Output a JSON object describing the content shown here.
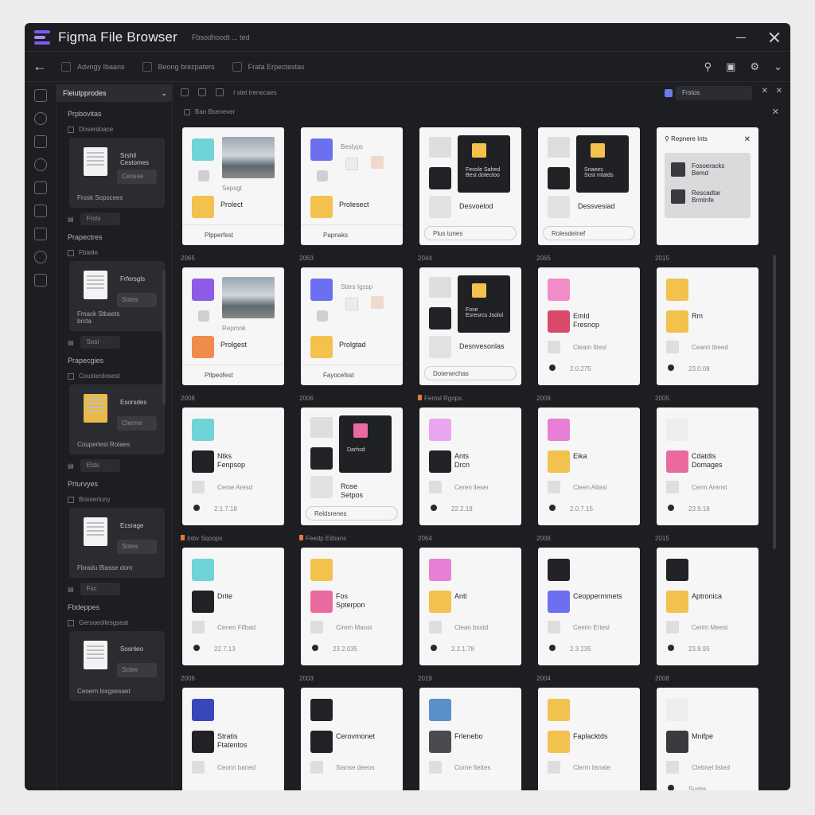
{
  "app": {
    "title": "Figma File Browser",
    "subtitle": "Fbsodhoodt ... ted"
  },
  "toolbar": {
    "crumbs": [
      "Advngy Ibaans",
      "Beong brezpaters",
      "Frata Erpectestas"
    ]
  },
  "panel": {
    "header": "Fleiutpprodes",
    "groups": [
      {
        "title": "Prpbovitas",
        "sub": "Doserdoace",
        "card_label": "Srshil\nCestomes",
        "card_pill": "Ceosse",
        "card_foot": "Frosk Sopscees",
        "btn": "Frsts",
        "doc": "doc"
      },
      {
        "title": "Prapectres",
        "sub": "Fbtelle",
        "card_label": "Frfersgls",
        "card_pill": "Sotes",
        "card_foot": "Fmack Stbaets\nbrcta",
        "btn": "Sosi",
        "doc": "doc"
      },
      {
        "title": "Prapecgies",
        "sub": "Cousterdosest",
        "card_label": "Esorsdes",
        "card_pill": "Clerme",
        "card_foot": "Couperlest Rotaes",
        "btn": "Etds",
        "doc": "folder"
      },
      {
        "title": "Prturvyes",
        "sub": "Bosseriuny",
        "card_label": "Ecsrage",
        "card_pill": "Sotes",
        "card_foot": "Fbradu Blasse dom",
        "btn": "Fsc",
        "doc": "doc"
      },
      {
        "title": "Fbdeppes",
        "sub": "Gersoeollesgseat",
        "card_label": "Sosnleo",
        "card_pill": "Sclee",
        "card_foot": "Ceoern losgsesaet",
        "btn": "",
        "doc": "doc"
      }
    ]
  },
  "main": {
    "head_label": "I stet trenecaes",
    "search": "Frstos",
    "section": "Ban Bsenever"
  },
  "cards": [
    {
      "row": "",
      "name": "Prolect",
      "meta": "Sepsgt",
      "foot": "Plpperfest",
      "icon": "#6fd3d8",
      "icon2": "#f2c14e",
      "kind": "photo"
    },
    {
      "row": "",
      "name": "Prolesect",
      "meta": "Beslyps",
      "foot": "Papnaks",
      "icon": "#6b6ff0",
      "icon2": "#f2c14e",
      "kind": "mini"
    },
    {
      "row": "",
      "name": "Desvoelod",
      "meta": "Feosle Sahed\nBest dotectoo",
      "foot": "Plus tunes",
      "icon": "#eeeeee",
      "icon2": "#222226",
      "kind": "dark"
    },
    {
      "row": "",
      "name": "Dessvesiad",
      "meta": "Snaees\nSost mlatds",
      "foot": "Rolesdeinef",
      "icon": "#eeeeee",
      "icon2": "#222226",
      "kind": "dark"
    },
    {
      "row": "",
      "name": "Repnere Ints",
      "meta": "Fosoeracks\nBemd",
      "foot": "Rescadtar\nBrmtnfe",
      "icon": "#eeeeee",
      "icon2": "#222226",
      "kind": "popup"
    },
    {
      "row": "2065",
      "name": "Prolgest",
      "meta": "Repmnk",
      "foot": "Ptlpeofest",
      "icon": "#8e5be8",
      "icon2": "#ef8c4b",
      "kind": "photo"
    },
    {
      "row": "2063",
      "name": "Prolgtad",
      "meta": "Sbtrs Igssp",
      "foot": "Fayocefsst",
      "icon": "#6b6ff0",
      "icon2": "#f2c14e",
      "kind": "mini"
    },
    {
      "row": "2044",
      "name": "Desnvesonlas",
      "meta": "Fose\nEsresrcs Jsolol",
      "foot": "Doterwrchas",
      "icon": "#222226",
      "icon2": "#222226",
      "kind": "dark"
    },
    {
      "row": "2065",
      "name": "Emld\nFresnop",
      "meta": "Cleam Itlesl",
      "foot": "2.0.275",
      "icon": "#f28cc6",
      "icon2": "#d94a6a",
      "kind": "item"
    },
    {
      "row": "2015",
      "name": "Rm",
      "meta": "Ceann tbeed",
      "foot": "23.0.08",
      "icon": "#f2c14e",
      "icon2": "#f2c14e",
      "kind": "item"
    },
    {
      "row": "2008",
      "name": "Ntks\nFenpsop",
      "meta": "Ceme Aresd",
      "foot": "2.1.7.18",
      "icon": "#6fd3d8",
      "icon2": "#222226",
      "kind": "item"
    },
    {
      "row": "2006",
      "name": "Rose\nSetpos",
      "meta": "Darhsd",
      "foot": "Reldsrenes",
      "icon": "#eeeeee",
      "icon2": "#222226",
      "kind": "dark2"
    },
    {
      "row": "Femsl Rgops",
      "name": "Ants\nDrcn",
      "meta": "Ceren lleser",
      "foot": "22.2.18",
      "icon": "#e9a6f0",
      "icon2": "#222226",
      "kind": "item"
    },
    {
      "row": "2009",
      "name": "Eika",
      "meta": "Cleen Altasl",
      "foot": "2.0.7.15",
      "icon": "#e77fd4",
      "icon2": "#f2c14e",
      "kind": "item"
    },
    {
      "row": "2005",
      "name": "Cdatdis\nDomages",
      "meta": "Cerm Arenst",
      "foot": "23.9.18",
      "icon": "#eeeeee",
      "icon2": "#ea6aa0",
      "kind": "item"
    },
    {
      "row": "Inbv Sqoops",
      "name": "Drite",
      "meta": "Cenen Fifbad",
      "foot": "22.7.13",
      "icon": "#6fd3d8",
      "icon2": "#222226",
      "kind": "item"
    },
    {
      "row": "Feedp Eiibans",
      "name": "Fos\nSpterpon",
      "meta": "Cirem Maost",
      "foot": "23 2.035",
      "icon": "#f2c14e",
      "icon2": "#ea6aa0",
      "kind": "item"
    },
    {
      "row": "2064",
      "name": "Anti",
      "meta": "Clean bsstd",
      "foot": "2.2.1.78",
      "icon": "#e77fd4",
      "icon2": "#f2c14e",
      "kind": "item"
    },
    {
      "row": "2006",
      "name": "Ceoppermmets",
      "meta": "Ceeim Ertesl",
      "foot": "2.3 235",
      "icon": "#222226",
      "icon2": "#6b6ff0",
      "kind": "item"
    },
    {
      "row": "2015",
      "name": "Aptronica",
      "meta": "Cerim Meest",
      "foot": "23.9.95",
      "icon": "#222226",
      "icon2": "#f2c14e",
      "kind": "item"
    },
    {
      "row": "2006",
      "name": "Stratis\nFtatentos",
      "meta": "Ceonn baned",
      "foot": "",
      "icon": "#3a47b8",
      "icon2": "#222226",
      "kind": "item"
    },
    {
      "row": "2003",
      "name": "Cerovmonet",
      "meta": "Sianse deeos",
      "foot": "",
      "icon": "#222226",
      "icon2": "#222226",
      "kind": "item"
    },
    {
      "row": "2019",
      "name": "Frlenebo",
      "meta": "Corne fiettes",
      "foot": "",
      "icon": "#5b8fc9",
      "icon2": "#4a4a50",
      "kind": "item"
    },
    {
      "row": "2004",
      "name": "Faplacktds",
      "meta": "Clerm itsnate",
      "foot": "",
      "icon": "#f2c14e",
      "icon2": "#f2c14e",
      "kind": "item"
    },
    {
      "row": "2008",
      "name": "Mnifpe",
      "meta": "Clebnel listed",
      "foot": "Susbs",
      "icon": "#eeeeee",
      "icon2": "#3b3b3f",
      "kind": "item"
    }
  ]
}
